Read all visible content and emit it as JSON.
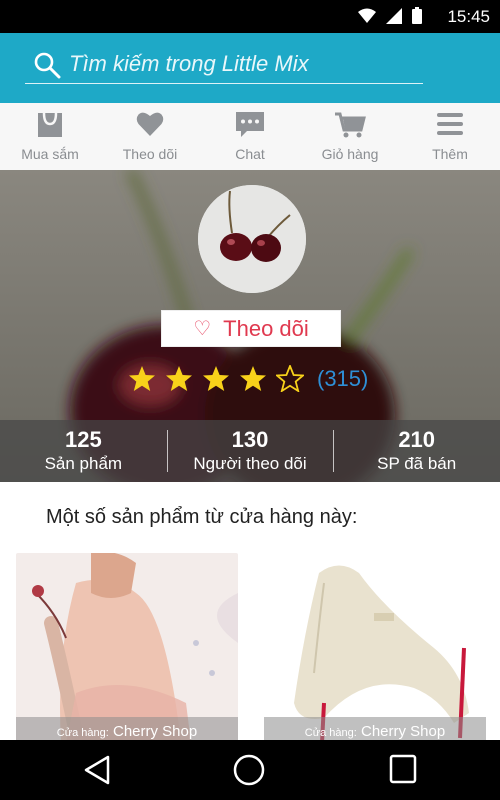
{
  "status_bar": {
    "time": "15:45"
  },
  "search": {
    "placeholder": "Tìm kiếm trong Little Mix"
  },
  "tabs": [
    {
      "label": "Mua sắm",
      "icon": "shopping-bag-icon"
    },
    {
      "label": "Theo dõi",
      "icon": "heart-icon"
    },
    {
      "label": "Chat",
      "icon": "chat-icon"
    },
    {
      "label": "Giỏ hàng",
      "icon": "cart-icon"
    },
    {
      "label": "Thêm",
      "icon": "menu-icon"
    }
  ],
  "store": {
    "follow_label": "Theo dõi",
    "rating_stars": 4,
    "rating_max": 5,
    "rating_count": "(315)",
    "stats": [
      {
        "value": "125",
        "label": "Sản phẩm"
      },
      {
        "value": "130",
        "label": "Người theo dõi"
      },
      {
        "value": "210",
        "label": "SP đã bán"
      }
    ]
  },
  "section_title": "Một số sản phẩm từ cửa hàng này:",
  "products": [
    {
      "shop_key": "Cửa hàng:",
      "shop_name": "Cherry Shop"
    },
    {
      "shop_key": "Cửa hàng:",
      "shop_name": "Cherry Shop"
    }
  ],
  "colors": {
    "accent": "#1ea9c7",
    "follow": "#e0394f",
    "rating_count": "#2e8fd6",
    "star": "#f8d21a"
  }
}
